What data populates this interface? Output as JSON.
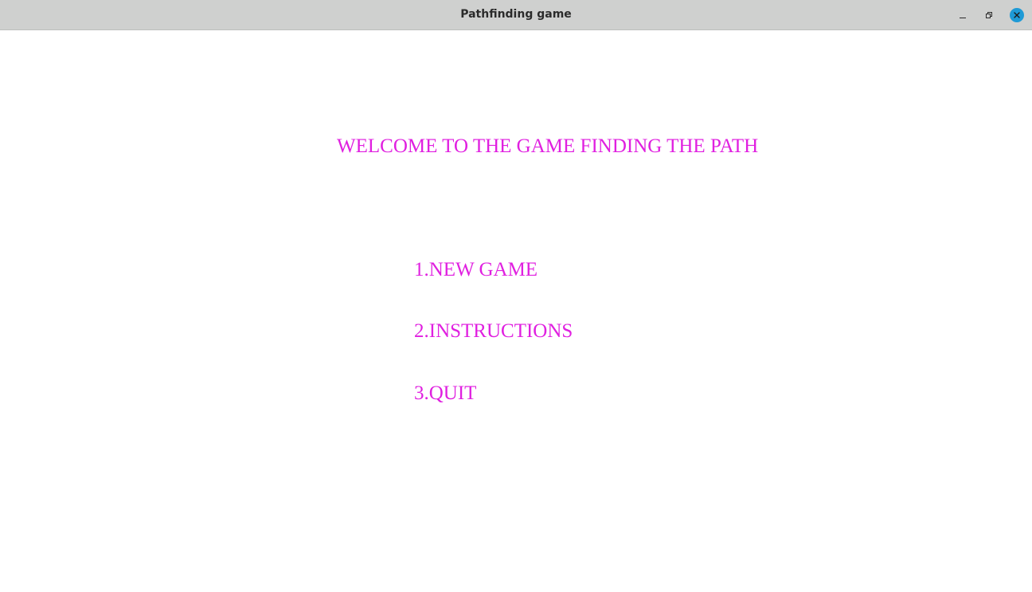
{
  "window": {
    "title": "Pathfinding game",
    "controls": {
      "minimize_icon": "minimize-icon",
      "maximize_icon": "restore-icon",
      "close_icon": "close-icon",
      "close_color": "#1e9ad6"
    }
  },
  "game": {
    "accent_color": "#e020e0",
    "welcome_text": "WELCOME TO THE GAME FINDING THE PATH",
    "menu": [
      {
        "label": "1.NEW GAME"
      },
      {
        "label": "2.INSTRUCTIONS"
      },
      {
        "label": "3.QUIT"
      }
    ]
  }
}
